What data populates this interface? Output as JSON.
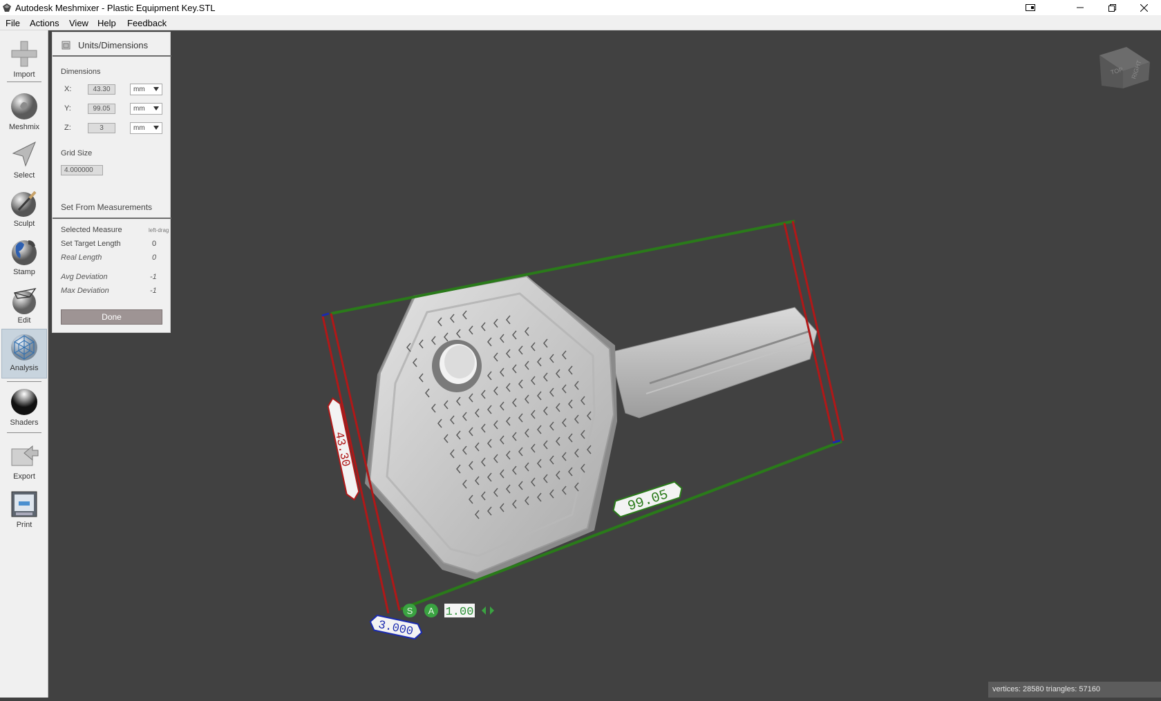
{
  "window": {
    "title": "Autodesk Meshmixer - Plastic Equipment Key.STL"
  },
  "menu": [
    "File",
    "Actions",
    "View",
    "Help",
    "Feedback"
  ],
  "tools": [
    {
      "label": "Import",
      "icon": "plus-icon"
    },
    {
      "label": "Meshmix",
      "icon": "bunny-sphere-icon"
    },
    {
      "label": "Select",
      "icon": "cursor-arrow-icon"
    },
    {
      "label": "Sculpt",
      "icon": "brush-sphere-icon"
    },
    {
      "label": "Stamp",
      "icon": "stamp-sphere-icon"
    },
    {
      "label": "Edit",
      "icon": "edit-sphere-icon"
    },
    {
      "label": "Analysis",
      "icon": "analysis-wireframe-sphere-icon",
      "active": true
    },
    {
      "label": "Shaders",
      "icon": "shader-sphere-icon"
    },
    {
      "label": "Export",
      "icon": "export-icon"
    },
    {
      "label": "Print",
      "icon": "printer-icon"
    }
  ],
  "panel": {
    "title": "Units/Dimensions",
    "dimensions_header": "Dimensions",
    "dims": [
      {
        "axis": "X:",
        "value": "43.30",
        "unit": "mm"
      },
      {
        "axis": "Y:",
        "value": "99.05",
        "unit": "mm"
      },
      {
        "axis": "Z:",
        "value": "3",
        "unit": "mm"
      }
    ],
    "grid_header": "Grid Size",
    "grid_value": "4.000000",
    "measure_header": "Set From Measurements",
    "selected_measure": {
      "label": "Selected Measure",
      "value": "left-drag"
    },
    "target_length": {
      "label": "Set Target Length",
      "value": "0"
    },
    "real_length": {
      "label": "Real Length",
      "value": "0"
    },
    "avg_deviation": {
      "label": "Avg Deviation",
      "value": "-1"
    },
    "max_deviation": {
      "label": "Max Deviation",
      "value": "-1"
    },
    "done_label": "Done"
  },
  "viewport": {
    "viewcube": {
      "top": "TOP",
      "right": "RIGHT"
    },
    "dims_labels": {
      "width": "43.30",
      "length": "99.05",
      "height": "3.000"
    },
    "scale_badges": {
      "s": "S",
      "a": "A",
      "value": "1.00"
    },
    "colors": {
      "x_axis": "#2a7a1a",
      "y_axis": "#b01818",
      "z_axis": "#1a2ab0",
      "mesh": "#c9c9c9",
      "background": "#414141"
    }
  },
  "status": {
    "text": "vertices: 28580 triangles: 57160"
  }
}
